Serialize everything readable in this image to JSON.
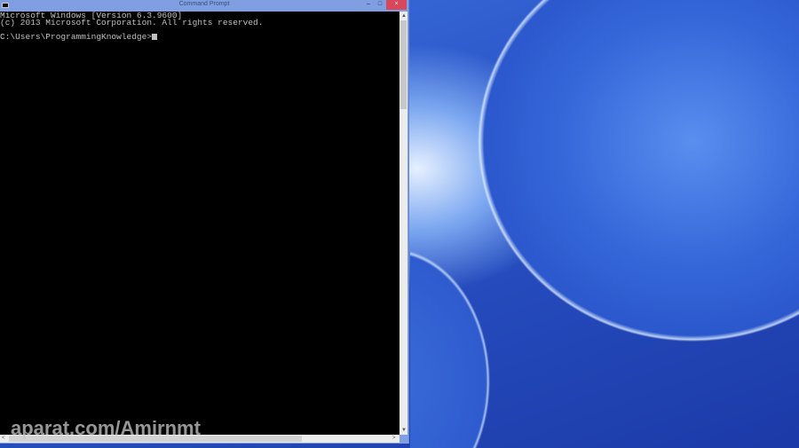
{
  "window": {
    "title": "Command Prompt",
    "minimize": "–",
    "maximize": "□",
    "close": "×"
  },
  "console": {
    "lines": [
      "Microsoft Windows [Version 6.3.9600]",
      "(c) 2013 Microsoft Corporation. All rights reserved.",
      ""
    ],
    "prompt": "C:\\Users\\ProgrammingKnowledge>"
  },
  "scroll": {
    "up": "▲",
    "down": "▼",
    "left": "<",
    "right": ">"
  },
  "watermark": "aparat.com/Amirnmt"
}
